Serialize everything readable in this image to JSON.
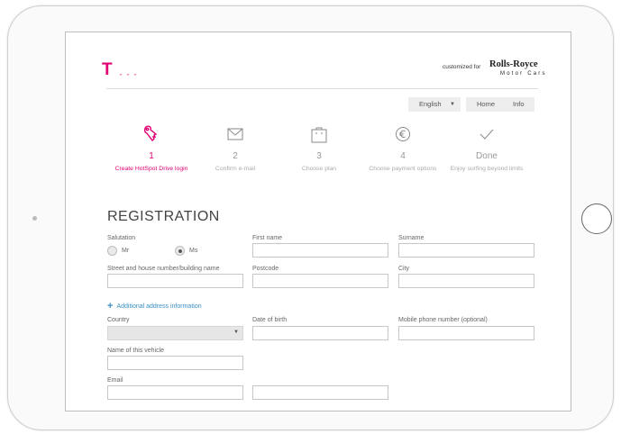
{
  "header": {
    "logo_mark": "T",
    "logo_dots": "···",
    "customized_for": "customized for",
    "brand_name": "Rolls-Royce",
    "brand_sub": "Motor Cars"
  },
  "nav": {
    "language": "English",
    "home": "Home",
    "info": "Info"
  },
  "steps": [
    {
      "num": "1",
      "label": "Create HotSpot Drive login",
      "icon": "key-icon",
      "active": true
    },
    {
      "num": "2",
      "label": "Confirm e-mail",
      "icon": "envelope-icon",
      "active": false
    },
    {
      "num": "3",
      "label": "Choose plan",
      "icon": "shopping-bag-icon",
      "active": false
    },
    {
      "num": "4",
      "label": "Choose payment options",
      "icon": "euro-icon",
      "active": false
    },
    {
      "num": "Done",
      "label": "Enjoy surfing beyond limits",
      "icon": "checkmark-icon",
      "active": false
    }
  ],
  "form": {
    "title": "REGISTRATION",
    "salutation": "Salutation",
    "mr": "Mr",
    "ms": "Ms",
    "selected_salutation": "Ms",
    "first_name": "First name",
    "surname": "Surname",
    "street": "Street and house number/building name",
    "postcode": "Postcode",
    "city": "City",
    "additional": "Additional address information",
    "country": "Country",
    "dob": "Date of birth",
    "mobile": "Mobile phone number (optional)",
    "vehicle": "Name of this vehicle",
    "email": "Email"
  },
  "colors": {
    "accent": "#e20074",
    "link": "#3b8ec2"
  }
}
